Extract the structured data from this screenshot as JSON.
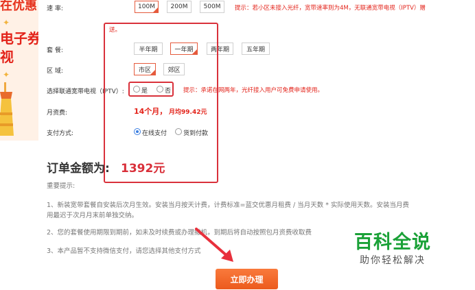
{
  "banner": {
    "line1": "在优惠",
    "line2": "电子券",
    "line3": "视"
  },
  "rate": {
    "label": "速 率:",
    "options": [
      "100M",
      "200M",
      "500M"
    ],
    "selected": "100M",
    "tip_line1": "提示：若小区未接入光纤，宽带速率则为4M，无联通宽带电视（IPTV）赠",
    "tip_line2": "送。"
  },
  "package": {
    "label": "套 餐:",
    "options": [
      "半年期",
      "一年期",
      "两年期",
      "五年期"
    ],
    "selected": "一年期"
  },
  "region": {
    "label": "区 域:",
    "options": [
      "市区",
      "郊区"
    ],
    "selected": "市区"
  },
  "iptv": {
    "label": "选择联通宽带电视（IPTV）:",
    "yes": "是",
    "no": "否",
    "tip": "提示：承诺在网两年，光纤接入用户可免费申请使用。"
  },
  "monthly_fee": {
    "label": "月资费:",
    "months": "14个月，",
    "avg": "月均99.42元"
  },
  "payment": {
    "label": "支付方式:",
    "online": "在线支付",
    "cod": "货到付款",
    "selected": "在线支付"
  },
  "order": {
    "label": "订单金额为:",
    "amount": "1392元"
  },
  "notes": {
    "title": "重要提示:",
    "n1_line1": "1、新装宽带套餐自安装后次月生效。安装当月按天计费，计费标准=蓝交优惠月租费 / 当月天数 * 实际使用天数。安装当月费",
    "n1_line2": "用最迟于次月月末前单独交纳。",
    "n2": "2、您的套餐使用期限到期前，如未及时续费或办理撤机，到期后将自动按照包月资费收取费",
    "n3": "3、本产品暂不支持微信支付，请您选择其他支付方式"
  },
  "submit_label": "立即办理",
  "watermark": {
    "title": "百科全说",
    "subtitle": "助你轻松解决"
  },
  "colors": {
    "accent": "#e55a3c",
    "highlight_red": "#d9303a",
    "button": "#ec5a1c",
    "watermark_green": "#1aa137",
    "radio_blue": "#3b7ee0"
  }
}
